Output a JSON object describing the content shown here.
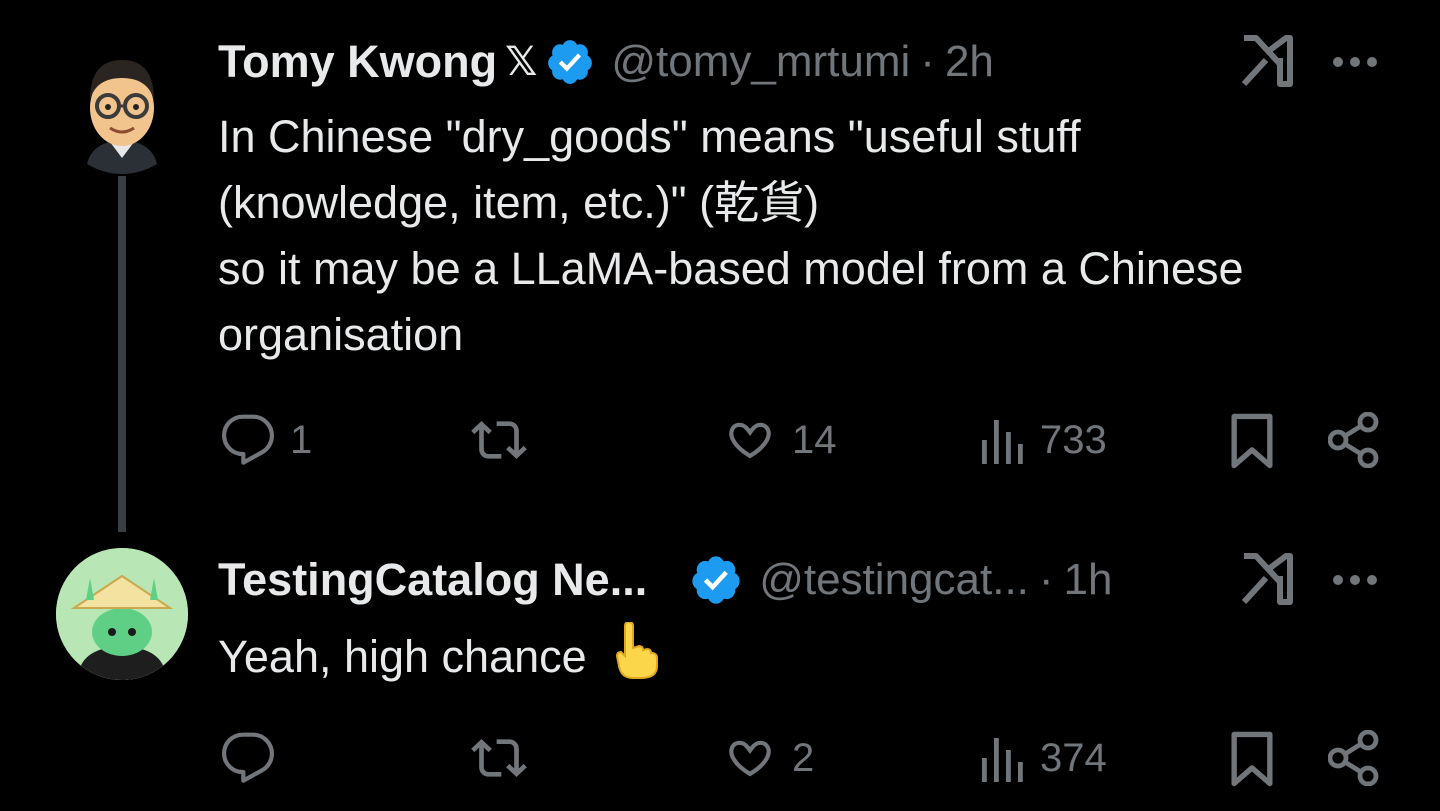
{
  "tweets": [
    {
      "display_name": "Tomy Kwong",
      "name_badge": "𝕏",
      "verified": true,
      "handle": "@tomy_mrtumi",
      "separator": "·",
      "time": "2h",
      "text_lines": [
        "In Chinese \"dry_goods\" means \"useful stuff",
        "(knowledge, item, etc.)\" (乾貨)",
        "so it may be a LLaMA-based model from a Chinese",
        "organisation"
      ],
      "stats": {
        "replies": "1",
        "reposts": "",
        "likes": "14",
        "views": "733"
      }
    },
    {
      "display_name": "TestingCatalog Ne...",
      "verified": true,
      "handle": "@testingcat...",
      "separator": "·",
      "time": "1h",
      "text": "Yeah, high chance",
      "emoji": "pointing-up-hand",
      "stats": {
        "replies": "",
        "reposts": "",
        "likes": "2",
        "views": "374"
      }
    }
  ],
  "colors": {
    "background": "#000000",
    "text": "#e7e9ea",
    "muted": "#71767b",
    "verified": "#1d9bf0",
    "thread_line": "#3a3d41"
  }
}
